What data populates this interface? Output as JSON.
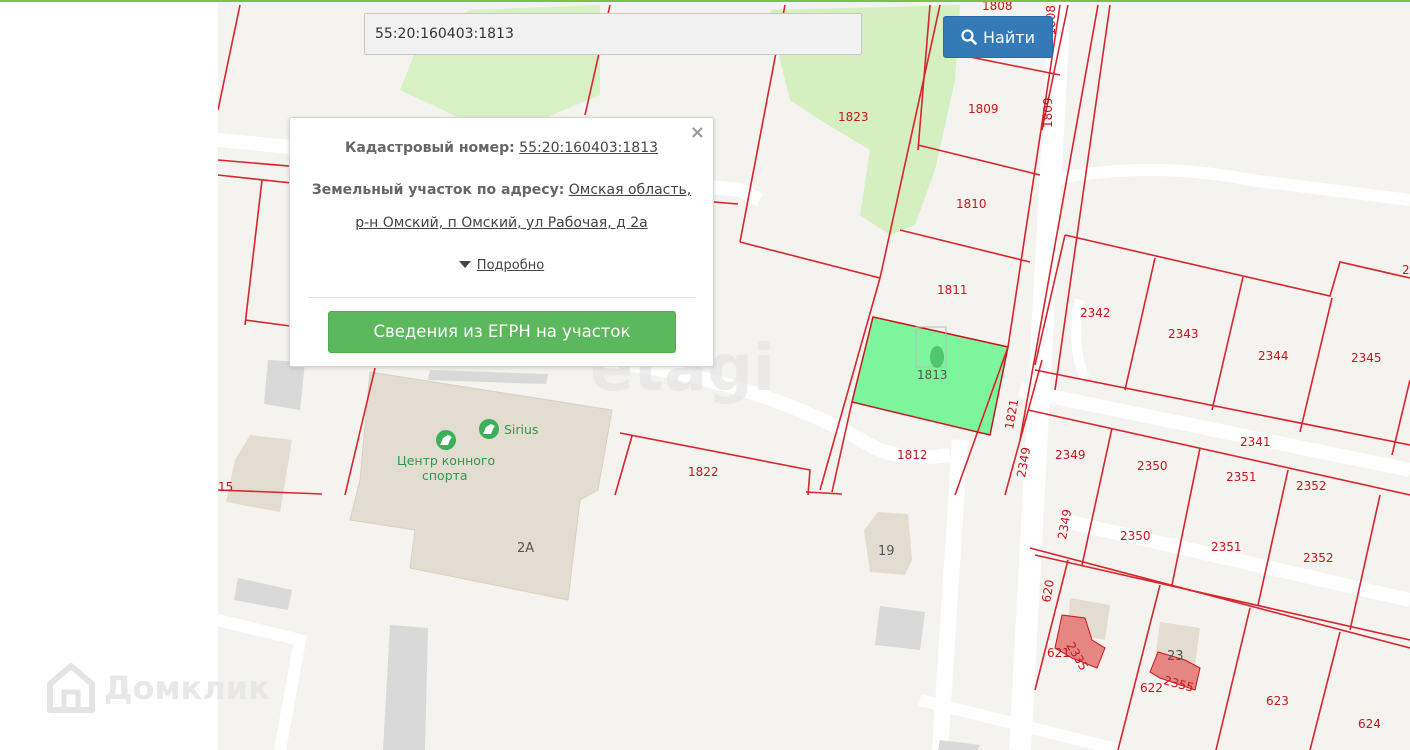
{
  "search": {
    "value": "55:20:160403:1813"
  },
  "search_button": {
    "label": "Найти"
  },
  "popup": {
    "cadastral_label": "Кадастровый номер:",
    "cadastral_value": "55:20:160403:1813",
    "address_label": "Земельный участок по адресу:",
    "address_line1": "Омская область,",
    "address_line2": "р-н Омский, п Омский, ул Рабочая, д 2а",
    "details_link": "Подробно",
    "close_label": "×",
    "egrn_button": "Сведения из ЕГРН на участок"
  },
  "map": {
    "plots": [
      "1808",
      "1808",
      "1809",
      "1809",
      "1823",
      "1810",
      "1811",
      "1813",
      "1812",
      "1821",
      "1822",
      "2342",
      "2343",
      "2344",
      "2345",
      "2341",
      "2349",
      "2349",
      "2350",
      "2351",
      "2352",
      "2349",
      "2350",
      "2351",
      "2352",
      "620",
      "621",
      "622",
      "623",
      "624",
      "2335",
      "2355",
      "15",
      "2"
    ],
    "buildings": [
      "2А",
      "19",
      "23"
    ],
    "poi": [
      "Sirius",
      "Центр конного",
      "спорта"
    ],
    "watermark_center": "etagi",
    "watermark_logo": "Домклик",
    "colors": {
      "selected_plot": "#7cf59c",
      "plot_border": "#d8242c",
      "greenery": "#d5f0c0",
      "road": "#ffffff",
      "building": "#e3dcd1"
    }
  },
  "icons": [
    "search-icon",
    "close-icon",
    "caret-down-icon",
    "horse-icon",
    "home-logo-icon",
    "broken-image-icon"
  ]
}
